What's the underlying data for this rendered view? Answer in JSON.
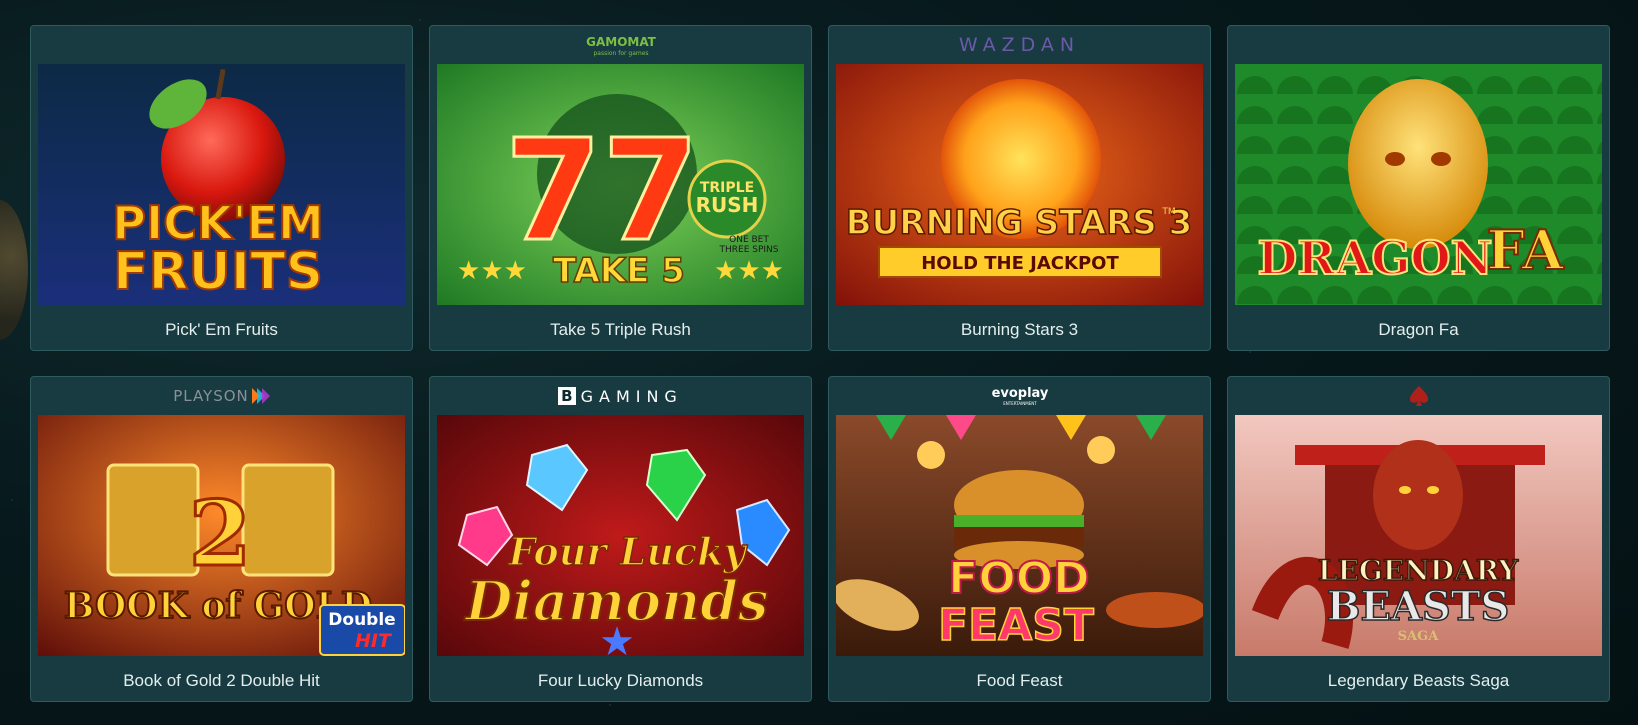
{
  "games": [
    {
      "name": "Pick' Em Fruits",
      "provider": "",
      "art_title": [
        "PICK'EM",
        "FRUITS"
      ]
    },
    {
      "name": "Take 5 Triple Rush",
      "provider": "GAMOMAT",
      "provider_tagline": "passion for games",
      "art_title": [
        "TAKE 5",
        "TRIPLE",
        "RUSH",
        "ONE BET",
        "THREE SPINS"
      ]
    },
    {
      "name": "Burning Stars 3",
      "provider": "WAZDAN",
      "art_title": [
        "BURNING STARS 3",
        "HOLD THE JACKPOT",
        "TM"
      ]
    },
    {
      "name": "Dragon Fa",
      "provider": "",
      "art_title": [
        "DRAGON",
        "FA"
      ]
    },
    {
      "name": "Book of Gold 2 Double Hit",
      "provider": "PLAYSON",
      "art_title": [
        "2",
        "BOOK of GOLD",
        "Double",
        "HIT"
      ]
    },
    {
      "name": "Four Lucky Diamonds",
      "provider": "GAMING",
      "provider_mark": "B",
      "art_title": [
        "Four Lucky",
        "Diamonds"
      ]
    },
    {
      "name": "Food Feast",
      "provider": "evoplay",
      "provider_tagline": "ENTERTAINMENT",
      "art_title": [
        "FOOD",
        "FEAST"
      ]
    },
    {
      "name": "Legendary Beasts Saga",
      "provider": "spade-logo",
      "art_title": [
        "LEGENDARY",
        "BEASTS",
        "SAGA"
      ]
    }
  ],
  "colors": {
    "card_bg": "#173b40",
    "card_border": "#2f5a5f",
    "page_bg": "#07191c",
    "text": "#e4eeee"
  }
}
